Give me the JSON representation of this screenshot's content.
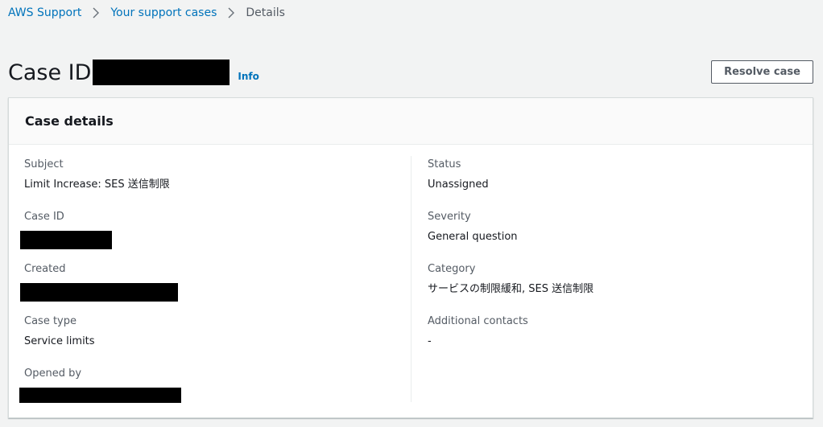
{
  "breadcrumb": {
    "items": [
      "AWS Support",
      "Your support cases"
    ],
    "current": "Details"
  },
  "header": {
    "title": "Case ID",
    "info": "Info",
    "resolve_label": "Resolve case"
  },
  "panel": {
    "title": "Case details",
    "left": [
      {
        "label": "Subject",
        "value": "Limit Increase: SES 送信制限"
      },
      {
        "label": "Case ID",
        "value": null
      },
      {
        "label": "Created",
        "value": null
      },
      {
        "label": "Case type",
        "value": "Service limits"
      },
      {
        "label": "Opened by",
        "value": null
      }
    ],
    "right": [
      {
        "label": "Status",
        "value": "Unassigned"
      },
      {
        "label": "Severity",
        "value": "General question"
      },
      {
        "label": "Category",
        "value": "サービスの制限緩和, SES 送信制限"
      },
      {
        "label": "Additional contacts",
        "value": "-"
      }
    ]
  },
  "colors": {
    "link": "#0073bb",
    "background": "#f2f3f3",
    "text": "#16191f",
    "muted": "#545b64"
  },
  "icons": {
    "separator": "chevron-right-icon"
  }
}
